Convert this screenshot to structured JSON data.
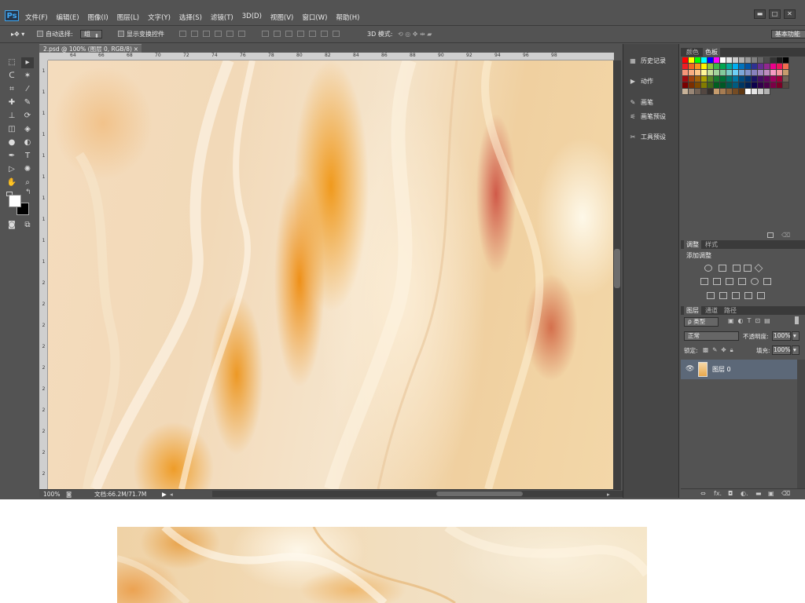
{
  "app": {
    "logo": "Ps"
  },
  "menu": [
    "文件(F)",
    "编辑(E)",
    "图像(I)",
    "图层(L)",
    "文字(Y)",
    "选择(S)",
    "滤镜(T)",
    "3D(D)",
    "视图(V)",
    "窗口(W)",
    "帮助(H)"
  ],
  "window_buttons": {
    "minimize": "▬",
    "maximize": "□",
    "close": "✕"
  },
  "options": {
    "auto_select_label": "自动选择:",
    "auto_select_value": "组",
    "show_transform_label": "显示变换控件",
    "mode3d_label": "3D 模式:",
    "workspace": "基本功能"
  },
  "document": {
    "tab_title": "2.psd @ 100% (图层 0, RGB/8)",
    "close_glyph": "×",
    "ruler_h": [
      "64",
      "66",
      "68",
      "70",
      "72",
      "74",
      "76",
      "78",
      "80",
      "82",
      "84",
      "86",
      "88",
      "90",
      "92",
      "94",
      "96",
      "98"
    ],
    "ruler_v": [
      "1",
      "1",
      "1",
      "1",
      "1",
      "1",
      "1",
      "1",
      "1",
      "1",
      "2",
      "2",
      "2",
      "2",
      "2",
      "2",
      "2",
      "2",
      "2",
      "2"
    ],
    "zoom": "100%",
    "doc_size": "文档:66.2M/71.7M"
  },
  "mid_panel": [
    {
      "icon": "history-icon",
      "glyph": "▦",
      "label": "历史记录"
    },
    {
      "icon": "actions-icon",
      "glyph": "▶",
      "label": "动作"
    },
    {
      "icon": "brush-icon",
      "glyph": "✎",
      "label": "画笔"
    },
    {
      "icon": "brush-presets-icon",
      "glyph": "⚟",
      "label": "画笔预设"
    },
    {
      "icon": "tool-presets-icon",
      "glyph": "✂",
      "label": "工具预设"
    }
  ],
  "color_panel": {
    "tabs": [
      "颜色",
      "色板"
    ],
    "active": "色板"
  },
  "adjust_panel": {
    "tabs": [
      "调整",
      "样式"
    ],
    "title": "添加调整"
  },
  "layers_panel": {
    "tabs": [
      "图层",
      "通道",
      "路径"
    ],
    "filter": "ρ 类型",
    "blend_mode": "正常",
    "opacity_label": "不透明度:",
    "opacity_value": "100%",
    "lock_label": "锁定:",
    "fill_label": "填充:",
    "fill_value": "100%",
    "layer_name": "图层 0",
    "footer_icons": [
      "⇔",
      "fx.",
      "◘",
      "◐.",
      "▬",
      "▣",
      "⌫"
    ]
  },
  "colors": {
    "ps_bg": "#535353",
    "panel_dark": "#474747",
    "selected_layer": "#5c6878",
    "ps_blue": "#3fa9f5"
  }
}
